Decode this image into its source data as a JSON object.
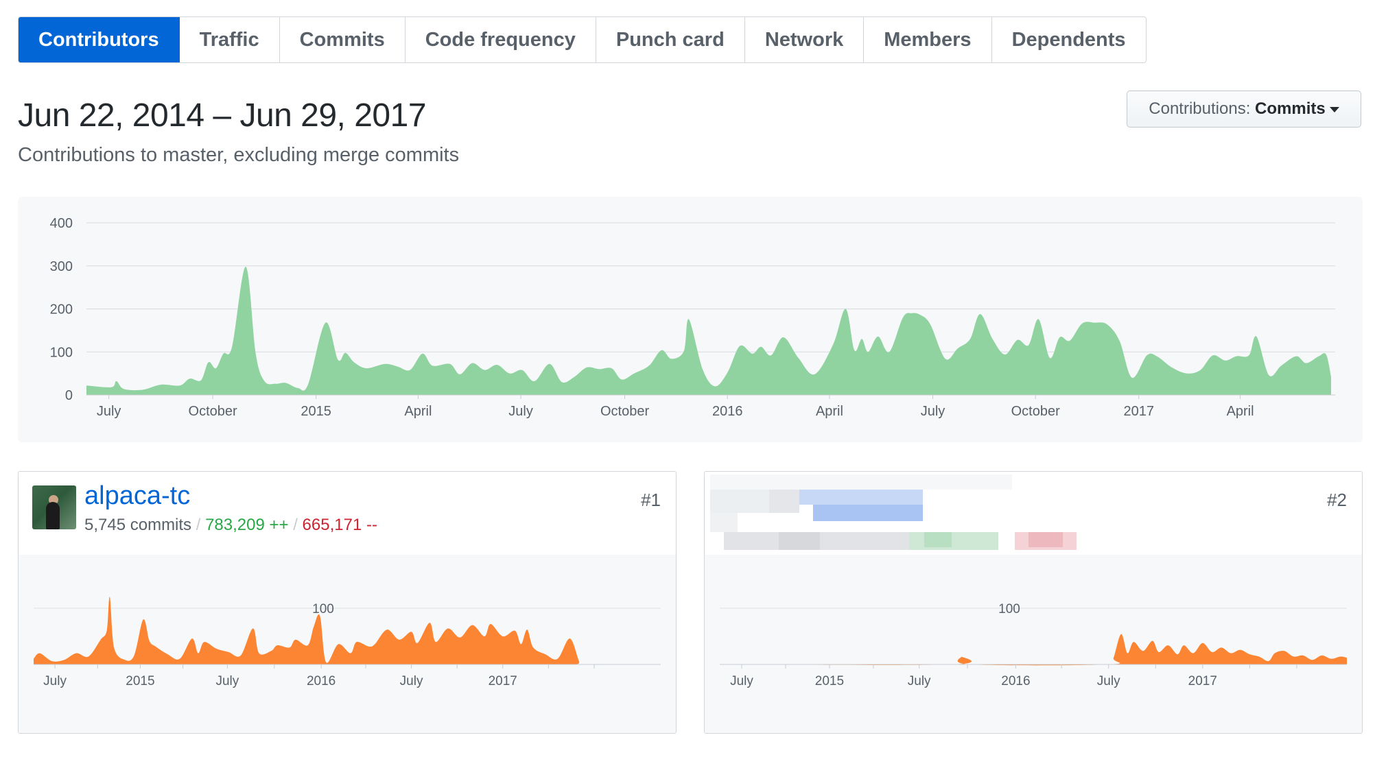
{
  "tabs": [
    {
      "label": "Contributors",
      "selected": true
    },
    {
      "label": "Traffic",
      "selected": false
    },
    {
      "label": "Commits",
      "selected": false
    },
    {
      "label": "Code frequency",
      "selected": false
    },
    {
      "label": "Punch card",
      "selected": false
    },
    {
      "label": "Network",
      "selected": false
    },
    {
      "label": "Members",
      "selected": false
    },
    {
      "label": "Dependents",
      "selected": false
    }
  ],
  "header": {
    "title": "Jun 22, 2014 – Jun 29, 2017",
    "subtitle": "Contributions to master, excluding merge commits"
  },
  "contributions_select": {
    "label": "Contributions:",
    "value": "Commits",
    "icon": "caret-down-icon"
  },
  "colors": {
    "accent": "#0366d6",
    "main_area": "#90d3a0",
    "contributor_area": "#fb8532",
    "additions": "#28a745",
    "deletions": "#cb2431"
  },
  "chart_data": [
    {
      "type": "area",
      "series": [
        {
          "values": [
            [
              0.0,
              22
            ],
            [
              0.02,
              18
            ],
            [
              0.024,
              32
            ],
            [
              0.03,
              14
            ],
            [
              0.045,
              12
            ],
            [
              0.06,
              24
            ],
            [
              0.075,
              22
            ],
            [
              0.083,
              38
            ],
            [
              0.092,
              34
            ],
            [
              0.098,
              76
            ],
            [
              0.104,
              62
            ],
            [
              0.11,
              96
            ],
            [
              0.117,
              112
            ],
            [
              0.128,
              298
            ],
            [
              0.136,
              96
            ],
            [
              0.143,
              32
            ],
            [
              0.152,
              26
            ],
            [
              0.16,
              28
            ],
            [
              0.17,
              16
            ],
            [
              0.178,
              24
            ],
            [
              0.192,
              168
            ],
            [
              0.202,
              82
            ],
            [
              0.208,
              98
            ],
            [
              0.215,
              76
            ],
            [
              0.225,
              62
            ],
            [
              0.24,
              72
            ],
            [
              0.25,
              66
            ],
            [
              0.26,
              58
            ],
            [
              0.27,
              96
            ],
            [
              0.278,
              68
            ],
            [
              0.292,
              72
            ],
            [
              0.3,
              48
            ],
            [
              0.31,
              74
            ],
            [
              0.32,
              58
            ],
            [
              0.33,
              70
            ],
            [
              0.34,
              50
            ],
            [
              0.35,
              58
            ],
            [
              0.36,
              32
            ],
            [
              0.372,
              72
            ],
            [
              0.382,
              30
            ],
            [
              0.392,
              42
            ],
            [
              0.402,
              64
            ],
            [
              0.412,
              60
            ],
            [
              0.422,
              62
            ],
            [
              0.43,
              36
            ],
            [
              0.44,
              50
            ],
            [
              0.452,
              68
            ],
            [
              0.462,
              104
            ],
            [
              0.47,
              84
            ],
            [
              0.48,
              102
            ],
            [
              0.484,
              176
            ],
            [
              0.495,
              60
            ],
            [
              0.505,
              20
            ],
            [
              0.515,
              52
            ],
            [
              0.525,
              114
            ],
            [
              0.535,
              96
            ],
            [
              0.542,
              112
            ],
            [
              0.55,
              92
            ],
            [
              0.56,
              134
            ],
            [
              0.572,
              86
            ],
            [
              0.585,
              48
            ],
            [
              0.6,
              118
            ],
            [
              0.61,
              200
            ],
            [
              0.617,
              104
            ],
            [
              0.623,
              130
            ],
            [
              0.628,
              100
            ],
            [
              0.636,
              136
            ],
            [
              0.645,
              100
            ],
            [
              0.656,
              180
            ],
            [
              0.663,
              190
            ],
            [
              0.67,
              186
            ],
            [
              0.678,
              164
            ],
            [
              0.69,
              84
            ],
            [
              0.7,
              108
            ],
            [
              0.71,
              130
            ],
            [
              0.718,
              188
            ],
            [
              0.728,
              130
            ],
            [
              0.738,
              94
            ],
            [
              0.748,
              128
            ],
            [
              0.757,
              116
            ],
            [
              0.765,
              176
            ],
            [
              0.774,
              86
            ],
            [
              0.782,
              134
            ],
            [
              0.79,
              126
            ],
            [
              0.8,
              166
            ],
            [
              0.81,
              168
            ],
            [
              0.82,
              164
            ],
            [
              0.83,
              126
            ],
            [
              0.84,
              40
            ],
            [
              0.852,
              92
            ],
            [
              0.86,
              90
            ],
            [
              0.872,
              64
            ],
            [
              0.884,
              50
            ],
            [
              0.895,
              58
            ],
            [
              0.905,
              92
            ],
            [
              0.915,
              80
            ],
            [
              0.924,
              90
            ],
            [
              0.934,
              92
            ],
            [
              0.94,
              136
            ],
            [
              0.95,
              46
            ],
            [
              0.96,
              68
            ],
            [
              0.972,
              90
            ],
            [
              0.98,
              74
            ],
            [
              0.99,
              90
            ],
            [
              0.996,
              94
            ],
            [
              1.0,
              42
            ]
          ]
        }
      ],
      "x_tick_labels": [
        "July",
        "October",
        "2015",
        "April",
        "July",
        "October",
        "2016",
        "April",
        "July",
        "October",
        "2017",
        "April"
      ],
      "y_tick_labels": [
        "0",
        "100",
        "200",
        "300",
        "400"
      ],
      "ylim": [
        0,
        400
      ],
      "grid": true
    },
    {
      "type": "area",
      "series": [
        {
          "values": [
            [
              0.0,
              10
            ],
            [
              0.01,
              20
            ],
            [
              0.03,
              6
            ],
            [
              0.05,
              8
            ],
            [
              0.07,
              20
            ],
            [
              0.09,
              14
            ],
            [
              0.11,
              44
            ],
            [
              0.12,
              60
            ],
            [
              0.125,
              120
            ],
            [
              0.132,
              30
            ],
            [
              0.15,
              8
            ],
            [
              0.165,
              16
            ],
            [
              0.18,
              80
            ],
            [
              0.19,
              42
            ],
            [
              0.2,
              32
            ],
            [
              0.22,
              18
            ],
            [
              0.24,
              10
            ],
            [
              0.26,
              46
            ],
            [
              0.27,
              20
            ],
            [
              0.28,
              40
            ],
            [
              0.3,
              28
            ],
            [
              0.32,
              22
            ],
            [
              0.34,
              16
            ],
            [
              0.36,
              64
            ],
            [
              0.37,
              20
            ],
            [
              0.39,
              24
            ],
            [
              0.4,
              34
            ],
            [
              0.42,
              30
            ],
            [
              0.43,
              44
            ],
            [
              0.45,
              34
            ],
            [
              0.46,
              68
            ],
            [
              0.47,
              86
            ],
            [
              0.48,
              4
            ],
            [
              0.5,
              36
            ],
            [
              0.52,
              20
            ],
            [
              0.53,
              40
            ],
            [
              0.55,
              32
            ],
            [
              0.56,
              36
            ],
            [
              0.58,
              62
            ],
            [
              0.6,
              44
            ],
            [
              0.62,
              58
            ],
            [
              0.63,
              38
            ],
            [
              0.65,
              74
            ],
            [
              0.66,
              40
            ],
            [
              0.68,
              64
            ],
            [
              0.7,
              48
            ],
            [
              0.72,
              70
            ],
            [
              0.74,
              50
            ],
            [
              0.75,
              72
            ],
            [
              0.77,
              50
            ],
            [
              0.79,
              60
            ],
            [
              0.8,
              36
            ],
            [
              0.81,
              62
            ],
            [
              0.82,
              30
            ],
            [
              0.84,
              18
            ],
            [
              0.86,
              10
            ],
            [
              0.88,
              46
            ],
            [
              0.895,
              6
            ],
            [
              0.9,
              0
            ],
            [
              1.0,
              0
            ]
          ]
        }
      ],
      "x_tick_labels": [
        "July",
        "2015",
        "July",
        "2016",
        "July",
        "2017"
      ],
      "y_tick_labels": [
        "100"
      ],
      "ylim": [
        0,
        100
      ]
    },
    {
      "type": "area",
      "series": [
        {
          "values": [
            [
              0.0,
              0
            ],
            [
              0.37,
              0
            ],
            [
              0.385,
              14
            ],
            [
              0.4,
              0
            ],
            [
              0.62,
              0
            ],
            [
              0.628,
              12
            ],
            [
              0.64,
              54
            ],
            [
              0.65,
              20
            ],
            [
              0.66,
              40
            ],
            [
              0.675,
              24
            ],
            [
              0.69,
              42
            ],
            [
              0.7,
              22
            ],
            [
              0.715,
              34
            ],
            [
              0.73,
              18
            ],
            [
              0.74,
              34
            ],
            [
              0.755,
              20
            ],
            [
              0.77,
              38
            ],
            [
              0.785,
              22
            ],
            [
              0.8,
              30
            ],
            [
              0.815,
              20
            ],
            [
              0.83,
              26
            ],
            [
              0.845,
              18
            ],
            [
              0.86,
              14
            ],
            [
              0.875,
              6
            ],
            [
              0.885,
              20
            ],
            [
              0.9,
              24
            ],
            [
              0.915,
              14
            ],
            [
              0.93,
              16
            ],
            [
              0.945,
              8
            ],
            [
              0.96,
              16
            ],
            [
              0.975,
              10
            ],
            [
              0.99,
              14
            ],
            [
              1.0,
              12
            ]
          ]
        }
      ],
      "x_tick_labels": [
        "July",
        "2015",
        "July",
        "2016",
        "July",
        "2017"
      ],
      "y_tick_labels": [
        "100"
      ],
      "ylim": [
        0,
        100
      ]
    }
  ],
  "contributors": [
    {
      "rank": "#1",
      "username": "alpaca-tc",
      "commits": "5,745 commits",
      "separator": "/",
      "additions": "783,209 ++",
      "deletions": "665,171 --"
    },
    {
      "rank": "#2"
    }
  ]
}
